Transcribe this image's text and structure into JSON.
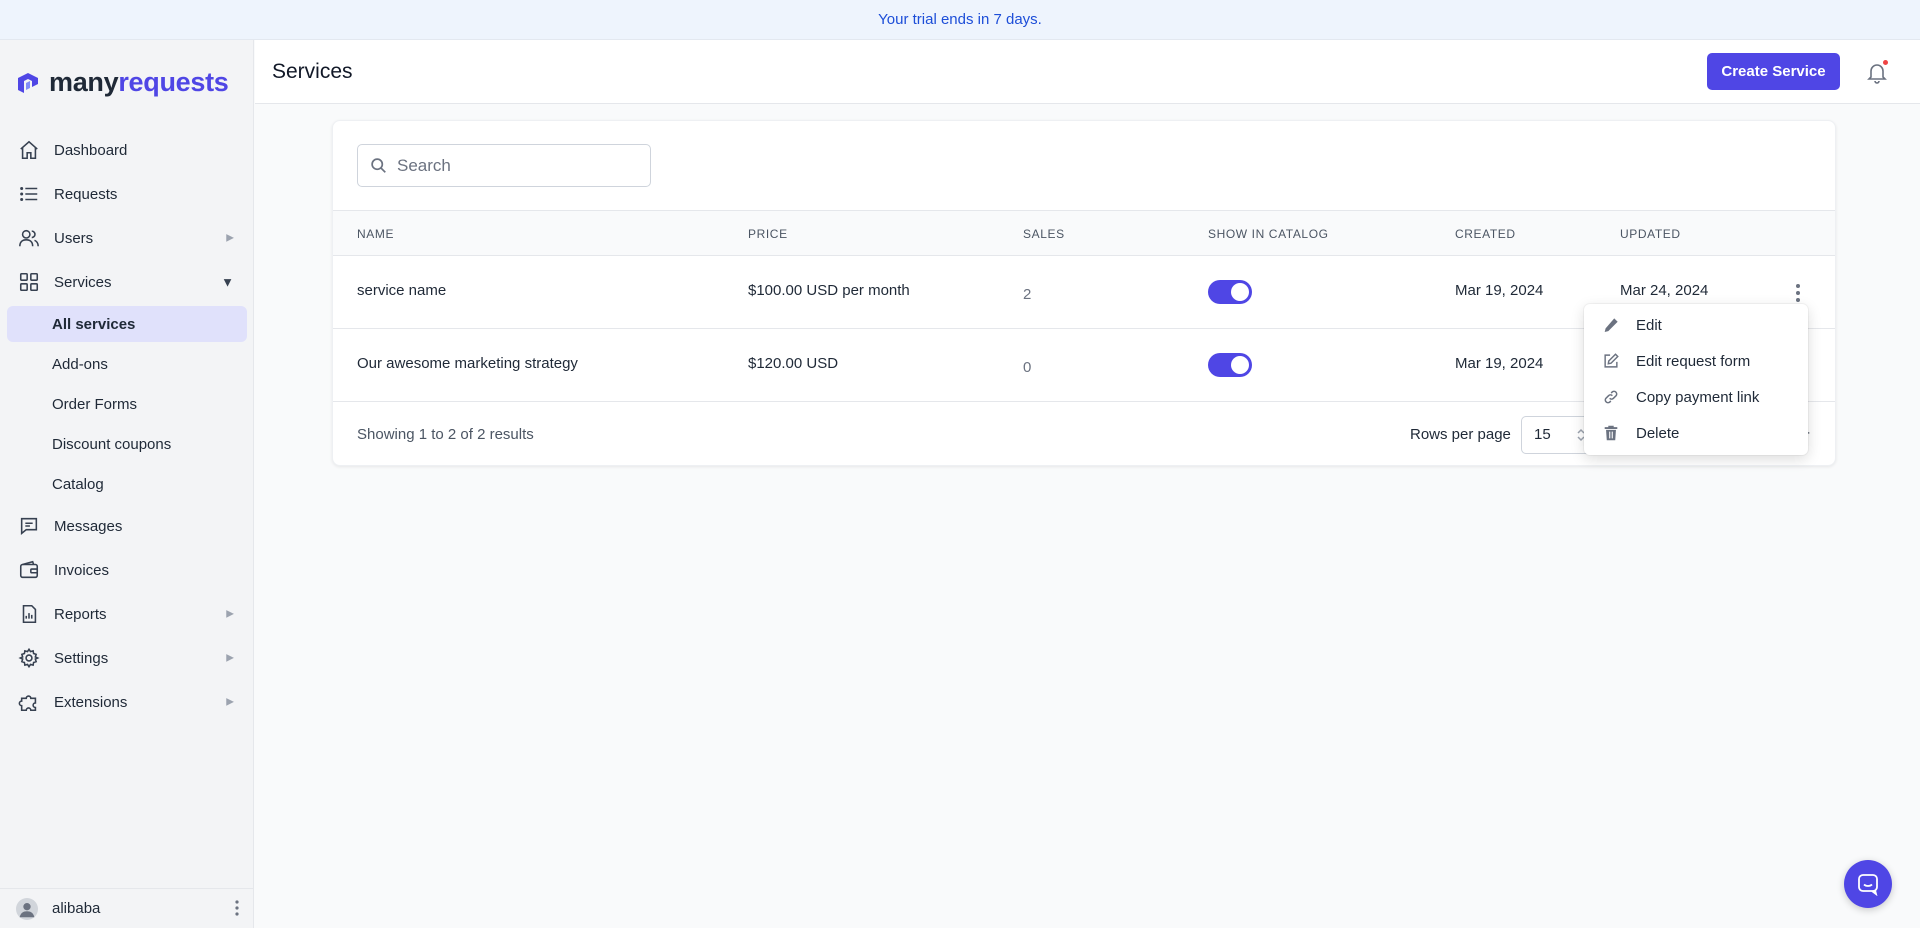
{
  "banner": {
    "text": "Your trial ends in 7 days."
  },
  "brand": {
    "part1": "many",
    "part2": "requests",
    "accent": "#4f46e5"
  },
  "sidebar": {
    "items": [
      {
        "label": "Dashboard",
        "icon": "home-icon"
      },
      {
        "label": "Requests",
        "icon": "list-icon"
      },
      {
        "label": "Users",
        "icon": "users-icon",
        "expandable": true
      },
      {
        "label": "Services",
        "icon": "grid-icon",
        "expanded": true
      },
      {
        "label": "Messages",
        "icon": "chat-icon"
      },
      {
        "label": "Invoices",
        "icon": "wallet-icon"
      },
      {
        "label": "Reports",
        "icon": "report-icon",
        "expandable": true
      },
      {
        "label": "Settings",
        "icon": "gear-icon",
        "expandable": true
      },
      {
        "label": "Extensions",
        "icon": "puzzle-icon",
        "expandable": true
      }
    ],
    "services_sub": [
      "All services",
      "Add-ons",
      "Order Forms",
      "Discount coupons",
      "Catalog"
    ],
    "user": "alibaba"
  },
  "header": {
    "title": "Services",
    "create_label": "Create Service"
  },
  "search": {
    "placeholder": "Search"
  },
  "table": {
    "columns": [
      "NAME",
      "PRICE",
      "SALES",
      "SHOW IN CATALOG",
      "CREATED",
      "UPDATED"
    ],
    "rows": [
      {
        "name": "service name",
        "price": "$100.00 USD per month",
        "sales": "2",
        "show_in_catalog": true,
        "created": "Mar 19, 2024",
        "updated": "Mar 24, 2024"
      },
      {
        "name": "Our awesome marketing strategy",
        "price": "$120.00 USD",
        "sales": "0",
        "show_in_catalog": true,
        "created": "Mar 19, 2024",
        "updated": ""
      }
    ],
    "footer": {
      "showing": "Showing 1 to 2 of 2 results",
      "rows_per_page_label": "Rows per page",
      "rows_per_page": "15",
      "trailing": "-"
    }
  },
  "row_menu": {
    "items": [
      {
        "label": "Edit",
        "icon": "pencil-icon"
      },
      {
        "label": "Edit request form",
        "icon": "edit-square-icon"
      },
      {
        "label": "Copy payment link",
        "icon": "link-icon"
      },
      {
        "label": "Delete",
        "icon": "trash-icon"
      }
    ]
  }
}
